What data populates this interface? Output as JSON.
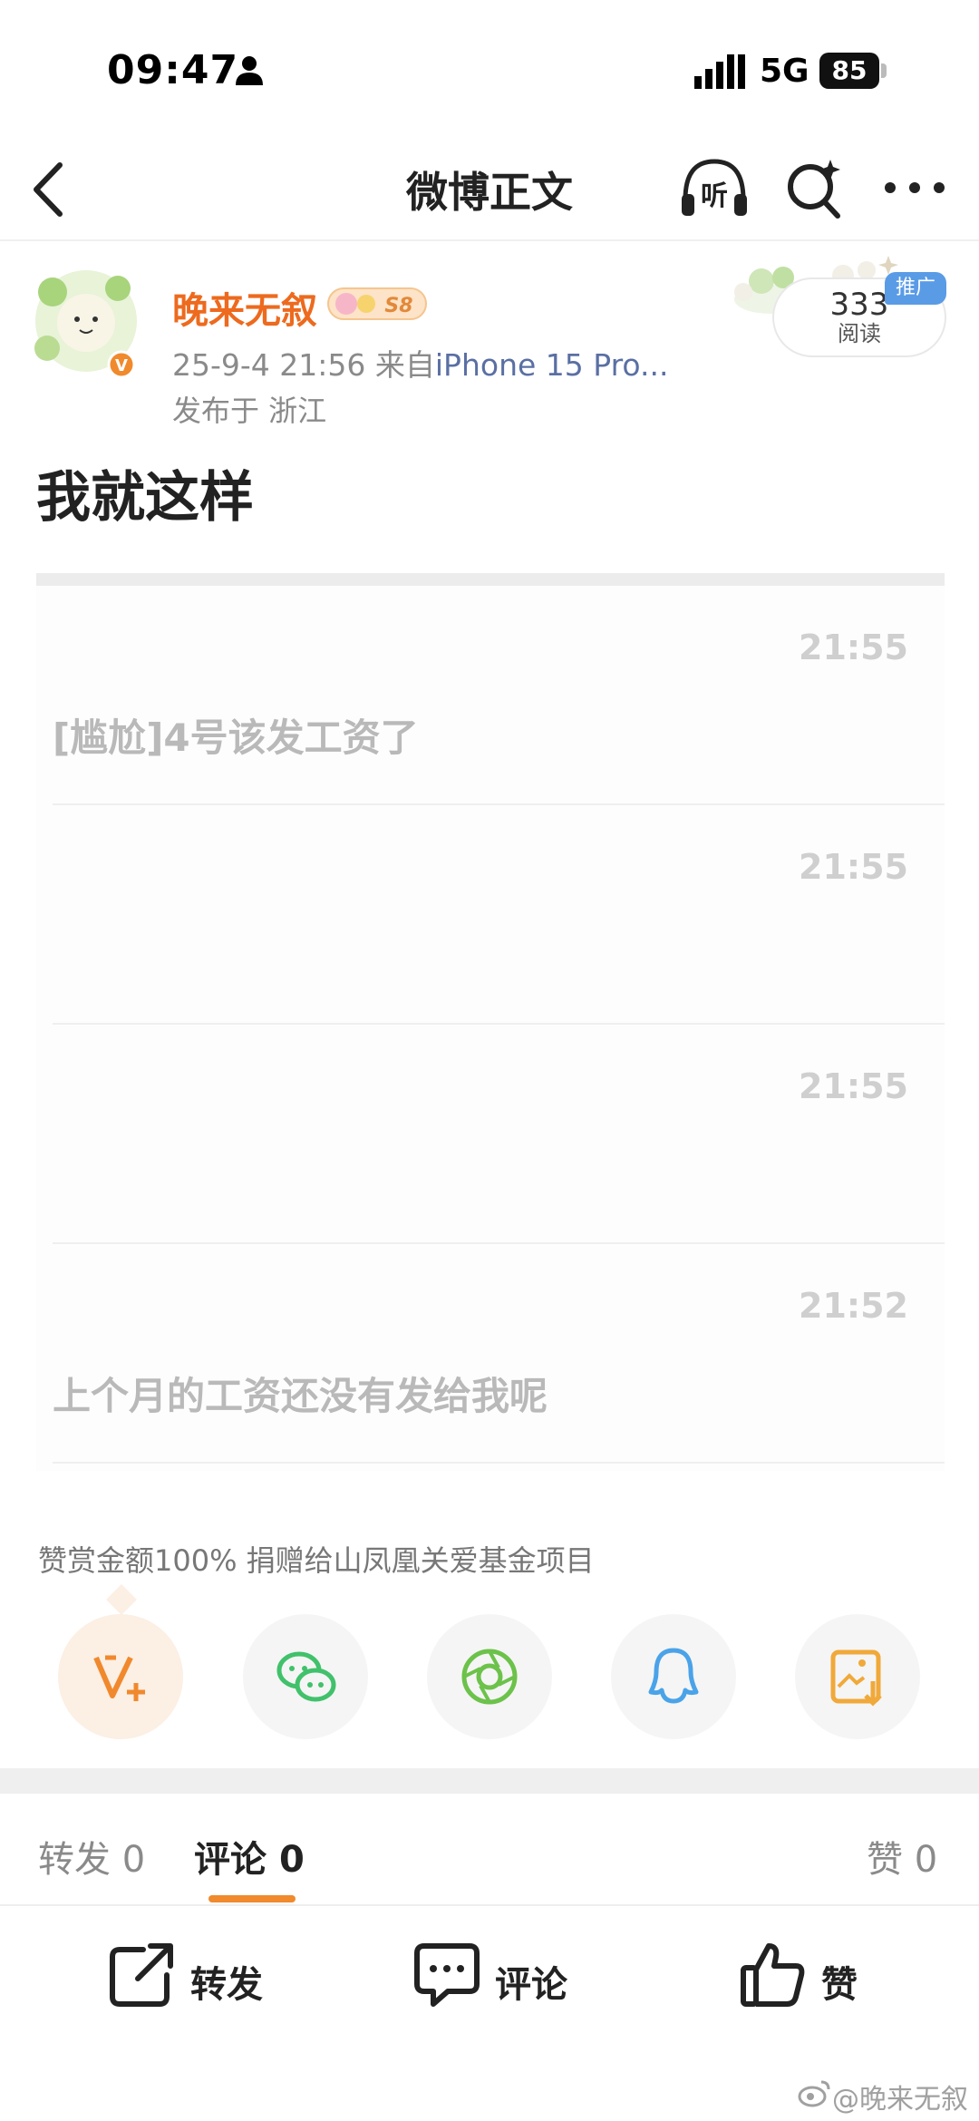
{
  "status_bar": {
    "time": "09:47",
    "network": "5G",
    "battery": "85"
  },
  "nav": {
    "title": "微博正文",
    "listen_label": "听"
  },
  "author": {
    "name": "晚来无叙",
    "badge_text": "S8",
    "meta_prefix": "25-9-4 21:56  来自",
    "source": "iPhone 15 Pro...",
    "location": "发布于 浙江",
    "read_count": "333",
    "read_label": "阅读",
    "promo_tag": "推广"
  },
  "post": {
    "text": "我就这样"
  },
  "screenshot": {
    "messages": [
      {
        "time": "21:55",
        "text": "[尴尬]4号该发工资了"
      },
      {
        "time": "21:55",
        "text": ""
      },
      {
        "time": "21:55",
        "text": ""
      },
      {
        "time": "21:52",
        "text": "上个月的工资还没有发给我呢"
      }
    ]
  },
  "donate": {
    "text": "赞赏金额100% 捐赠给山凤凰关爱基金项目"
  },
  "share": {
    "icons": [
      "vplus-icon",
      "wechat-icon",
      "moments-icon",
      "qq-icon",
      "save-image-icon"
    ],
    "colors": {
      "vplus": "#f0892d",
      "wechat": "#41c16b",
      "moments": "#6cc24a",
      "qq": "#4aa3e8",
      "save": "#f0a93a"
    }
  },
  "tabs": {
    "repost": {
      "label": "转发",
      "count": "0"
    },
    "comment": {
      "label": "评论",
      "count": "0"
    },
    "like": {
      "label": "赞",
      "count": "0"
    }
  },
  "actions": {
    "repost": "转发",
    "comment": "评论",
    "like": "赞"
  },
  "watermark": {
    "text": "@晚来无叙"
  },
  "colors": {
    "accent": "#ed6a1e",
    "tab_underline": "#f08a2c",
    "link": "#5a6fa3"
  }
}
